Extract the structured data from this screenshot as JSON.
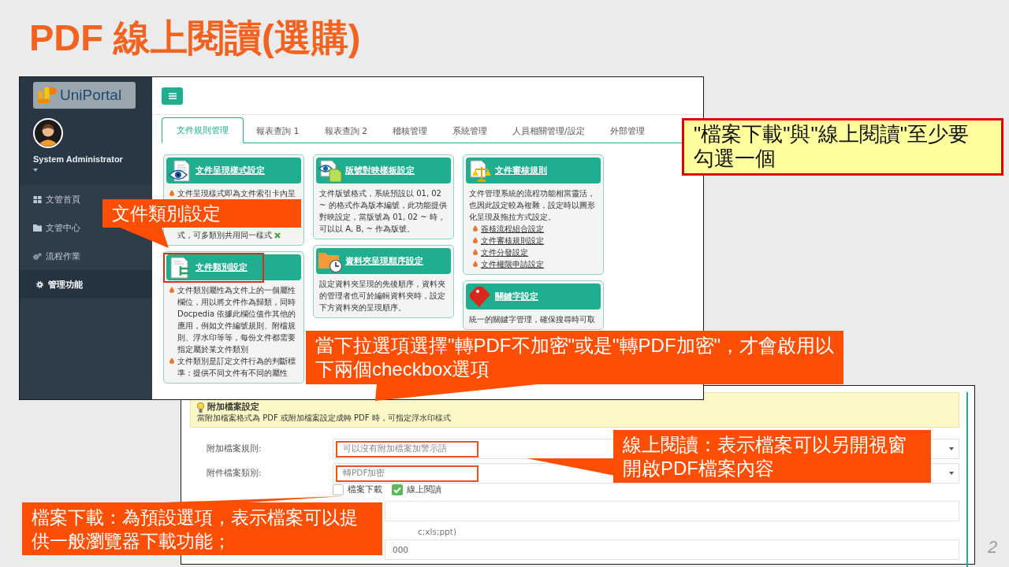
{
  "slide": {
    "title": "PDF 線上閱讀(選購)",
    "page_number": "2"
  },
  "admin_screenshot": {
    "sidebar": {
      "logo_text": "UniPortal",
      "user_name": "System Administrator",
      "menu": [
        {
          "label": "文管首頁",
          "selected": false
        },
        {
          "label": "文管中心",
          "selected": false
        },
        {
          "label": "流程作業",
          "selected": false
        },
        {
          "label": "管理功能",
          "selected": true
        }
      ]
    },
    "tabs": [
      {
        "label": "文件規則管理",
        "selected": true
      },
      {
        "label": "報表查詢 1",
        "selected": false
      },
      {
        "label": "報表查詢 2",
        "selected": false
      },
      {
        "label": "稽核管理",
        "selected": false
      },
      {
        "label": "系統管理",
        "selected": false
      },
      {
        "label": "人員相關管理/設定",
        "selected": false
      },
      {
        "label": "外部管理",
        "selected": false
      }
    ],
    "card_columns": [
      [
        {
          "title": "文件呈現樣式設定",
          "highlighted": false,
          "body": [
            {
              "kind": "bullet_fragment",
              "text": "文件呈現樣式即為文件索引卡內呈"
            },
            {
              "kind": "continuation",
              "text": "式，可多類別共用同一樣式",
              "icon_after": true
            }
          ]
        },
        {
          "title": "文件類別設定",
          "highlighted": true,
          "body": [
            {
              "kind": "bullet",
              "text": "文件類別屬性為文件上的一個屬性欄位，用以將文件作為歸類，同時 Docpedia 依據此欄位值作其他的應用，例如文件編號規則、附檔規則、浮水印等等，每份文件都需要指定屬於某文件類別"
            },
            {
              "kind": "bullet",
              "text": "文件類別是訂定文件行為的判斷標準：提供不同文件有不同的屬性"
            }
          ]
        }
      ],
      [
        {
          "title": "版號對映樣板設定",
          "highlighted": false,
          "body": [
            {
              "kind": "paragraph",
              "text": "文件版號格式，系統預設以 01, 02 ~ 的格式作為版本編號，此功能提供對映設定，當版號為 01, 02 ~ 時，可以以 A, B, ~ 作為版號。"
            }
          ]
        },
        {
          "title": "資料夾呈現順序設定",
          "highlighted": false,
          "body": [
            {
              "kind": "paragraph",
              "text": "設定資料夾呈現的先後順序，資料夾的管理者也可於編輯資料夾時，設定下方資料夾的呈現順序。"
            }
          ]
        }
      ],
      [
        {
          "title": "文件審核規則",
          "highlighted": false,
          "body": [
            {
              "kind": "paragraph",
              "text": "文件管理系統的流程功能相當靈活，也因此設定較為複雜，設定時以圖形化呈現及拖拉方式設定。"
            },
            {
              "kind": "link",
              "text": "簽核流程組合設定"
            },
            {
              "kind": "link",
              "text": "文件審核規則設定"
            },
            {
              "kind": "link",
              "text": "文件分發設定"
            },
            {
              "kind": "link",
              "text": "文件權限申請設定"
            }
          ]
        },
        {
          "title": "關鍵字設定",
          "highlighted": false,
          "body": [
            {
              "kind": "paragraph",
              "text": "統一的關鍵字管理，確保搜尋時可取"
            }
          ]
        }
      ]
    ]
  },
  "attachment_screenshot": {
    "notice": {
      "title": "附加檔案設定",
      "text": "當附加檔案格式為 PDF 或附加檔案設定成轉 PDF 時，可指定浮水印樣式"
    },
    "selects": [
      {
        "label": "附加檔案規則:",
        "value": "可以沒有附加檔案加警示語",
        "highlighted": true
      },
      {
        "label": "附件檔案類別:",
        "value": "轉PDF加密",
        "highlighted": true
      }
    ],
    "checkboxes": [
      {
        "label": "檔案下載",
        "checked": false
      },
      {
        "label": "線上閱讀",
        "checked": true
      }
    ],
    "lower_rows": [
      {
        "kind": "field"
      },
      {
        "kind": "hint",
        "text": "c;xls;ppt)"
      },
      {
        "kind": "field",
        "value": "000"
      }
    ]
  },
  "callouts": [
    {
      "kind": "speech",
      "text": "文件類別設定"
    },
    {
      "kind": "note",
      "text": "\"檔案下載\"與\"線上閱讀\"至少要勾選一個"
    },
    {
      "kind": "speech",
      "text": "當下拉選項選擇\"轉PDF不加密\"或是\"轉PDF加密\"，才會啟用以下兩個checkbox選項"
    },
    {
      "kind": "speech",
      "text": "線上閱讀：表示檔案可以另開視窗開啟PDF檔案內容"
    },
    {
      "kind": "speech",
      "text": "檔案下載：為預設選項，表示檔案可以提供一般瀏覽器下載功能；"
    }
  ]
}
